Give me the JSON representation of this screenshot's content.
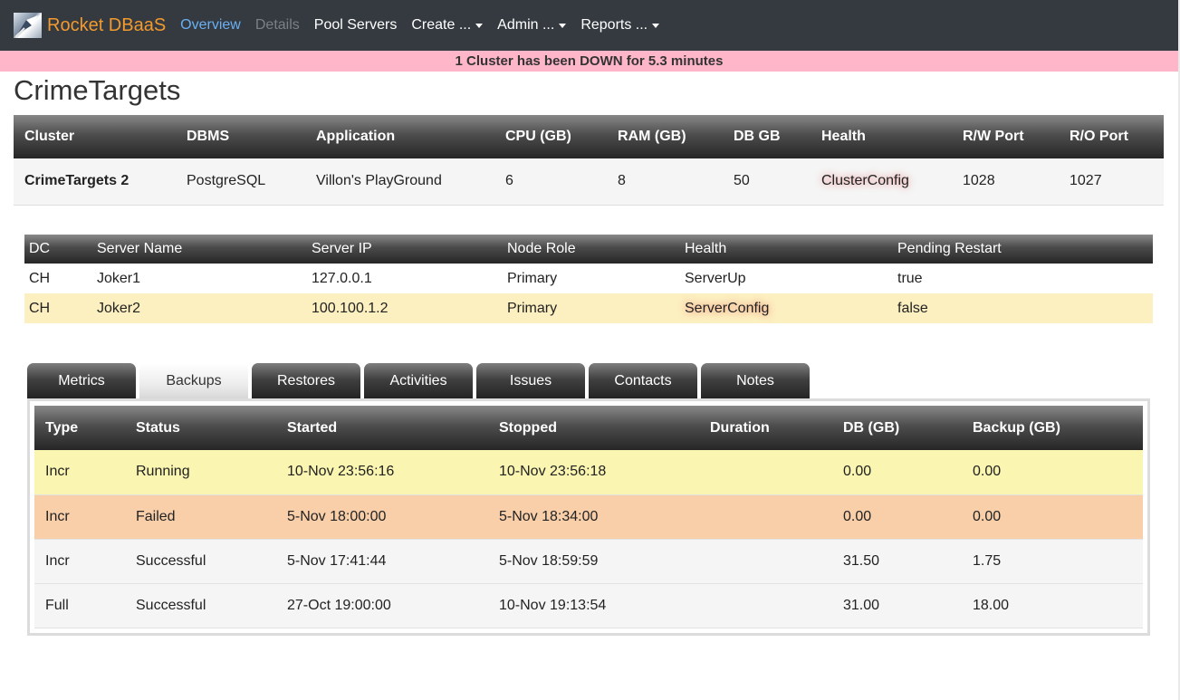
{
  "nav": {
    "brand": "Rocket DBaaS",
    "brand_logo_icon": "rocket-logo-icon",
    "links": [
      {
        "label": "Overview",
        "state": "active"
      },
      {
        "label": "Details",
        "state": "disabled"
      },
      {
        "label": "Pool Servers",
        "state": "normal"
      },
      {
        "label": "Create ...",
        "state": "dropdown"
      },
      {
        "label": "Admin ...",
        "state": "dropdown"
      },
      {
        "label": "Reports ...",
        "state": "dropdown"
      }
    ]
  },
  "alert": {
    "message": "1 Cluster has been DOWN for 5.3 minutes",
    "color": "#ffb6c8"
  },
  "page": {
    "title": "CrimeTargets"
  },
  "cluster": {
    "headers": [
      "Cluster",
      "DBMS",
      "Application",
      "CPU (GB)",
      "RAM (GB)",
      "DB GB",
      "Health",
      "R/W Port",
      "R/O Port"
    ],
    "row": {
      "cluster": "CrimeTargets 2",
      "dbms": "PostgreSQL",
      "application": "Villon's PlayGround",
      "cpu": "6",
      "ram": "8",
      "db_gb": "50",
      "health": "ClusterConfig",
      "rw_port": "1028",
      "ro_port": "1027"
    }
  },
  "servers": {
    "headers": [
      "DC",
      "Server Name",
      "Server IP",
      "Node Role",
      "Health",
      "Pending Restart"
    ],
    "rows": [
      {
        "dc": "CH",
        "name": "Joker1",
        "ip": "127.0.0.1",
        "role": "Primary",
        "health": "ServerUp",
        "pending_restart": "true"
      },
      {
        "dc": "CH",
        "name": "Joker2",
        "ip": "100.100.1.2",
        "role": "Primary",
        "health": "ServerConfig",
        "pending_restart": "false"
      }
    ]
  },
  "tabs": {
    "items": [
      "Metrics",
      "Backups",
      "Restores",
      "Activities",
      "Issues",
      "Contacts",
      "Notes"
    ],
    "active": "Backups"
  },
  "backups": {
    "headers": [
      "Type",
      "Status",
      "Started",
      "Stopped",
      "Duration",
      "DB (GB)",
      "Backup (GB)"
    ],
    "rows": [
      {
        "type": "Incr",
        "status": "Running",
        "started": "10-Nov 23:56:16",
        "stopped": "10-Nov 23:56:18",
        "duration": "",
        "db_gb": "0.00",
        "backup_gb": "0.00"
      },
      {
        "type": "Incr",
        "status": "Failed",
        "started": "5-Nov 18:00:00",
        "stopped": "5-Nov 18:34:00",
        "duration": "",
        "db_gb": "0.00",
        "backup_gb": "0.00"
      },
      {
        "type": "Incr",
        "status": "Successful",
        "started": "5-Nov 17:41:44",
        "stopped": "5-Nov 18:59:59",
        "duration": "",
        "db_gb": "31.50",
        "backup_gb": "1.75"
      },
      {
        "type": "Full",
        "status": "Successful",
        "started": "27-Oct 19:00:00",
        "stopped": "10-Nov 19:13:54",
        "duration": "",
        "db_gb": "31.00",
        "backup_gb": "18.00"
      }
    ]
  },
  "colors": {
    "navbar": "#343a40",
    "brand": "#f29a2e",
    "active_link": "#6ab0f3",
    "row_running": "#faf5b0",
    "row_failed": "#f9cfaa",
    "row_server_warning": "#fcefc0"
  }
}
